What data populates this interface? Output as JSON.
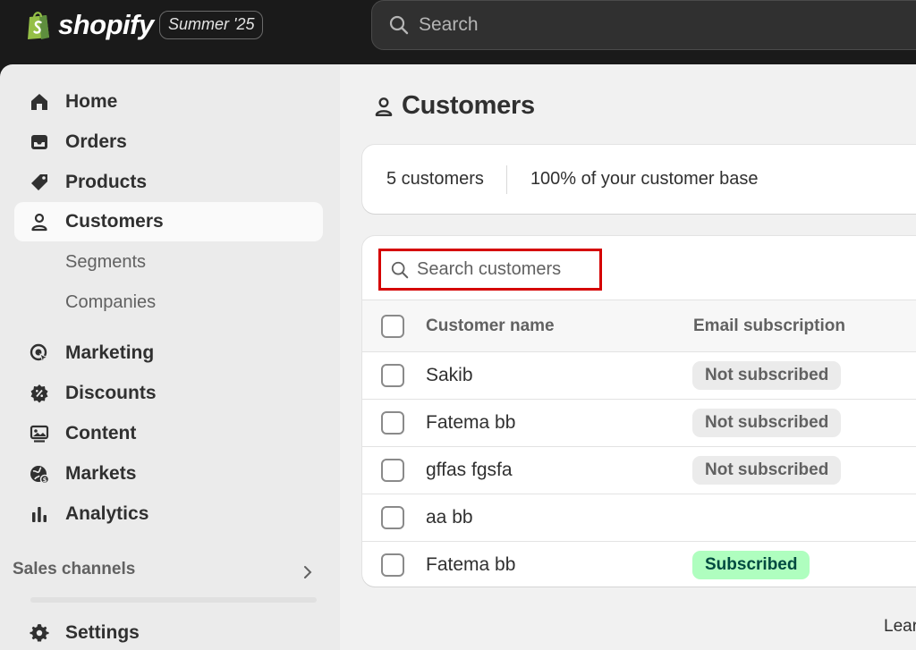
{
  "topbar": {
    "brand": "shopify",
    "edition": "Summer '25",
    "search_placeholder": "Search",
    "colors": {
      "background": "#1a1a1a",
      "brand_bag": "#95bf47"
    }
  },
  "sidebar": {
    "items": [
      {
        "label": "Home",
        "icon": "home-icon"
      },
      {
        "label": "Orders",
        "icon": "inbox-icon"
      },
      {
        "label": "Products",
        "icon": "tag-icon"
      },
      {
        "label": "Customers",
        "icon": "person-icon",
        "active": true
      },
      {
        "label": "Segments"
      },
      {
        "label": "Companies"
      },
      {
        "label": "Marketing",
        "icon": "target-icon"
      },
      {
        "label": "Discounts",
        "icon": "discount-icon"
      },
      {
        "label": "Content",
        "icon": "content-icon"
      },
      {
        "label": "Markets",
        "icon": "globe-icon"
      },
      {
        "label": "Analytics",
        "icon": "bar-chart-icon"
      }
    ],
    "sales_channels_label": "Sales channels",
    "settings_label": "Settings"
  },
  "main": {
    "page_title": "Customers",
    "stats": {
      "count": "5 customers",
      "base": "100% of your customer base"
    },
    "search_placeholder": "Search customers",
    "table": {
      "columns": [
        "Customer name",
        "Email subscription"
      ],
      "rows": [
        {
          "name": "Sakib",
          "subscription": "Not subscribed"
        },
        {
          "name": "Fatema bb",
          "subscription": "Not subscribed"
        },
        {
          "name": "gffas fgsfa",
          "subscription": "Not subscribed"
        },
        {
          "name": "aa bb",
          "subscription": ""
        },
        {
          "name": "Fatema bb",
          "subscription": "Subscribed"
        }
      ]
    },
    "footer_text": "Lear",
    "colors": {
      "subscribed_badge": "#affebf",
      "not_subscribed_badge": "#ebebeb",
      "highlight_box": "#d50000"
    }
  }
}
